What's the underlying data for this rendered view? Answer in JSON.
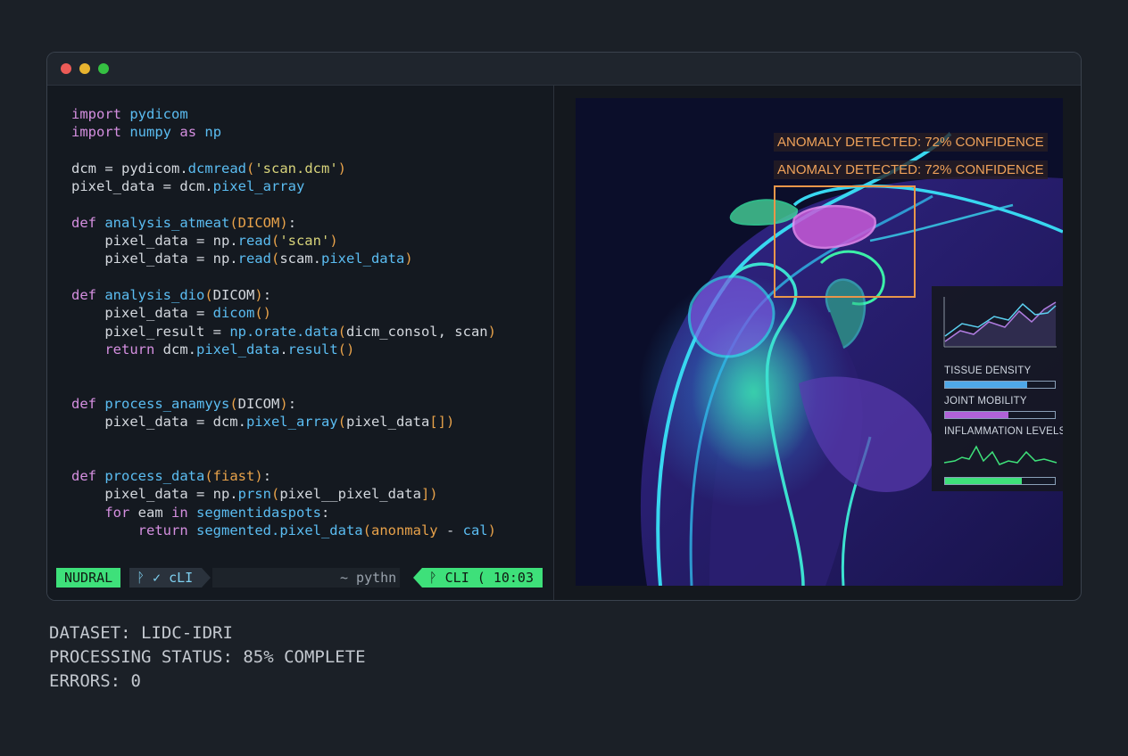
{
  "code_lines": [
    [
      [
        "kw",
        "import"
      ],
      [
        "txt",
        " "
      ],
      [
        "fn",
        "pydicom"
      ]
    ],
    [
      [
        "kw",
        "import"
      ],
      [
        "txt",
        " "
      ],
      [
        "fn",
        "numpy"
      ],
      [
        "txt",
        " "
      ],
      [
        "kw",
        "as"
      ],
      [
        "txt",
        " "
      ],
      [
        "fn",
        "np"
      ]
    ],
    [],
    [
      [
        "txt",
        "dcm = pydicom."
      ],
      [
        "fn",
        "dcmread"
      ],
      [
        "par",
        "("
      ],
      [
        "str",
        "'scan.dcm'"
      ],
      [
        "par",
        ")"
      ]
    ],
    [
      [
        "txt",
        "pixel_data = dcm."
      ],
      [
        "fn",
        "pixel_array"
      ]
    ],
    [],
    [
      [
        "kw",
        "def"
      ],
      [
        "txt",
        " "
      ],
      [
        "fn",
        "analysis_atmeat"
      ],
      [
        "par",
        "("
      ],
      [
        "par",
        "DICOM"
      ],
      [
        "par",
        ")"
      ],
      [
        "txt",
        ":"
      ]
    ],
    [
      [
        "txt",
        "    pixel_data = np."
      ],
      [
        "fn",
        "read"
      ],
      [
        "par",
        "("
      ],
      [
        "str",
        "'scan'"
      ],
      [
        "par",
        ")"
      ]
    ],
    [
      [
        "txt",
        "    pixel_data = np."
      ],
      [
        "fn",
        "read"
      ],
      [
        "par",
        "("
      ],
      [
        "txt",
        "scam."
      ],
      [
        "fn",
        "pixel_data"
      ],
      [
        "par",
        ")"
      ]
    ],
    [],
    [
      [
        "kw",
        "def"
      ],
      [
        "txt",
        " "
      ],
      [
        "fn",
        "analysis_dio"
      ],
      [
        "par",
        "("
      ],
      [
        "txt",
        "DICOM"
      ],
      [
        "par",
        ")"
      ],
      [
        "txt",
        ":"
      ]
    ],
    [
      [
        "txt",
        "    pixel_data = "
      ],
      [
        "fn",
        "dicom"
      ],
      [
        "par",
        "()"
      ]
    ],
    [
      [
        "txt",
        "    pixel_result = "
      ],
      [
        "fn",
        "np.orate.data"
      ],
      [
        "par",
        "("
      ],
      [
        "txt",
        "dicm_consol, scan"
      ],
      [
        "par",
        ")"
      ]
    ],
    [
      [
        "txt",
        "    "
      ],
      [
        "kw",
        "return"
      ],
      [
        "txt",
        " dcm."
      ],
      [
        "fn",
        "pixel_data"
      ],
      [
        "txt",
        "."
      ],
      [
        "fn",
        "result"
      ],
      [
        "par",
        "()"
      ]
    ],
    [],
    [],
    [
      [
        "kw",
        "def"
      ],
      [
        "txt",
        " "
      ],
      [
        "fn",
        "process_anamyys"
      ],
      [
        "par",
        "("
      ],
      [
        "txt",
        "DICOM"
      ],
      [
        "par",
        ")"
      ],
      [
        "txt",
        ":"
      ]
    ],
    [
      [
        "txt",
        "    pixel_data = dcm."
      ],
      [
        "fn",
        "pixel_array"
      ],
      [
        "par",
        "("
      ],
      [
        "txt",
        "pixel_data"
      ],
      [
        "par",
        "[])"
      ]
    ],
    [],
    [],
    [
      [
        "kw",
        "def"
      ],
      [
        "txt",
        " "
      ],
      [
        "fn",
        "process_data"
      ],
      [
        "par",
        "("
      ],
      [
        "par",
        "fiast"
      ],
      [
        "par",
        ")"
      ],
      [
        "txt",
        ":"
      ]
    ],
    [
      [
        "txt",
        "    pixel_data = np."
      ],
      [
        "fn",
        "prsn"
      ],
      [
        "par",
        "("
      ],
      [
        "txt",
        "pixel__pixel_data"
      ],
      [
        "par",
        "])"
      ]
    ],
    [
      [
        "txt",
        "    "
      ],
      [
        "kw",
        "for"
      ],
      [
        "txt",
        " eam "
      ],
      [
        "kw",
        "in"
      ],
      [
        "txt",
        " "
      ],
      [
        "fn",
        "segmentidaspots"
      ],
      [
        "txt",
        ":"
      ]
    ],
    [
      [
        "txt",
        "        "
      ],
      [
        "kw",
        "return"
      ],
      [
        "txt",
        " "
      ],
      [
        "fn",
        "segmented.pixel_data"
      ],
      [
        "par",
        "("
      ],
      [
        "par",
        "anonmaly"
      ],
      [
        "txt",
        " - "
      ],
      [
        "fn",
        "cal"
      ],
      [
        "par",
        ")"
      ]
    ]
  ],
  "statusbar": {
    "mode": "NUDRAL",
    "branch": "ᚹ ✓ cLI",
    "lang": "~ pythn",
    "right": "ᚹ CLI (  10:03"
  },
  "viewer": {
    "anomaly_label_1": "ANOMALY DETECTED: 72% CONFIDENCE",
    "anomaly_label_2": "ANOMALY DETECTED: 72% CONFIDENCE",
    "stats": {
      "tissue_density_label": "TISSUE DENSITY",
      "joint_mobility_label": "JOINT MOBILITY",
      "inflammation_label": "INFLAMMATION LEVELS",
      "tissue_density_level": 0.75,
      "joint_mobility_level": 0.58,
      "inflammation_level": 0.7
    }
  },
  "footer": {
    "dataset": "DATASET: LIDC-IDRI",
    "status": "PROCESSING STATUS: 85% COMPLETE",
    "errors": "ERRORS: 0"
  },
  "colors": {
    "keyword": "#d58fe0",
    "function": "#5bbdf2",
    "string": "#d7d37a",
    "param": "#e8a24a",
    "accent_green": "#3ee07a",
    "anomaly_orange": "#e8964a"
  }
}
